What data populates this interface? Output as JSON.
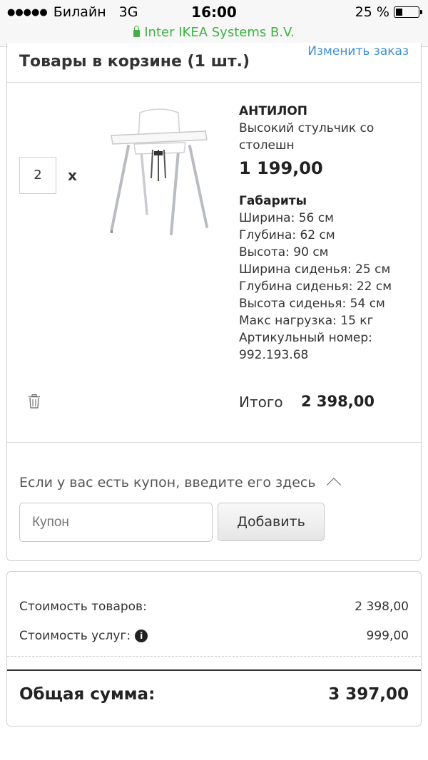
{
  "status_bar": {
    "signal": "●●●●●",
    "carrier": "Билайн",
    "network": "3G",
    "time": "16:00",
    "battery": "25 %",
    "battery_level": 0.25,
    "url": "Inter IKEA Systems B.V."
  },
  "cart": {
    "title": "Товары в корзине (1 шт.)",
    "change_link": "Изменить заказ",
    "item": {
      "quantity": "2",
      "multiply": "x",
      "name": "АНТИЛОП",
      "description": "Высокий стульчик со столешн",
      "price": "1 199,00",
      "dimensions_title": "Габариты",
      "dimensions": [
        "Ширина: 56 см",
        "Глубина: 62 см",
        "Высота: 90 см",
        "Ширина сиденья: 25 см",
        "Глубина сиденья: 22 см",
        "Высота сиденья: 54 см",
        "Макс нагрузка: 15 кг",
        "Артикульный номер: 992.193.68"
      ],
      "total_label": "Итого",
      "total_value": "2 398,00"
    },
    "coupon": {
      "prompt": "Если у вас есть купон, введите его здесь",
      "placeholder": "Купон",
      "add_button": "Добавить"
    }
  },
  "summary": {
    "goods_label": "Стоимость товаров:",
    "goods_value": "2 398,00",
    "services_label": "Стоимость услуг:",
    "services_value": "999,00",
    "grand_label": "Общая сумма:",
    "grand_value": "3 397,00"
  },
  "colors": {
    "link": "#3a8fd6",
    "secure": "#3fb146"
  }
}
